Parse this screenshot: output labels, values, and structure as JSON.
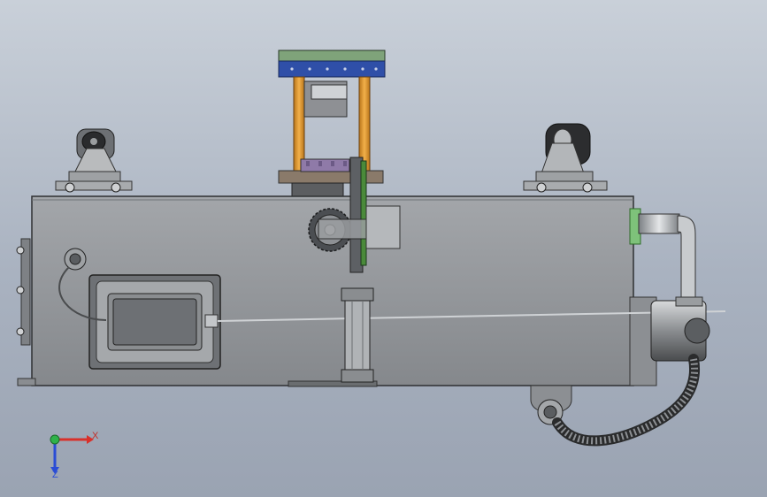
{
  "axes": {
    "x_label": "X",
    "z_label": "Z"
  },
  "colors": {
    "background_top": "#c9d0d9",
    "background_bottom": "#9aa3b2",
    "housing": "#8f9296",
    "housing_edge": "#2e3032",
    "column": "#e39a2a",
    "plate_blue": "#2f4fa8",
    "plate_green": "#7fa37a",
    "axis_x": "#d9302a",
    "axis_y": "#2fb24a",
    "axis_z": "#2a4cd6"
  }
}
